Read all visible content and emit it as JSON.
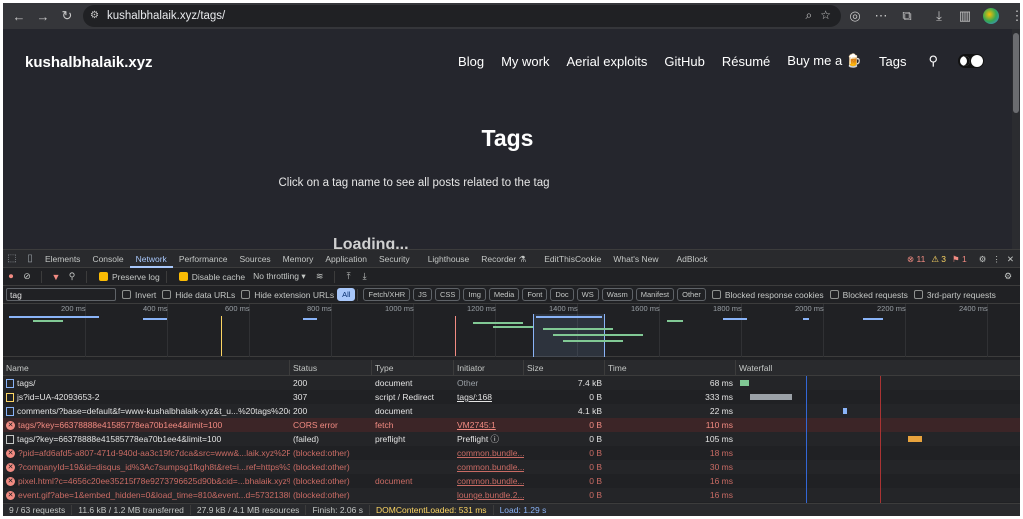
{
  "browser": {
    "url": "kushalbhalaik.xyz/tags/"
  },
  "site": {
    "title": "kushalbhalaik.xyz",
    "nav": [
      "Blog",
      "My work",
      "Aerial exploits",
      "GitHub",
      "Résumé",
      "Buy me a 🍺",
      "Tags"
    ],
    "heading": "Tags",
    "subheading": "Click on a tag name to see all posts related to the tag",
    "loading": "Loading..."
  },
  "devtools": {
    "tabs": [
      "Elements",
      "Console",
      "Network",
      "Performance",
      "Sources",
      "Memory",
      "Application",
      "Security",
      "Lighthouse",
      "Recorder ⚗",
      "EditThisCookie",
      "What's New",
      "AdBlock"
    ],
    "active_tab": "Network",
    "counts": {
      "errors": "11",
      "warnings": "3",
      "info": "1"
    },
    "toolbar": {
      "preserve_log": "Preserve log",
      "disable_cache": "Disable cache",
      "throttling": "No throttling"
    },
    "filter": {
      "value": "tag",
      "invert": "Invert",
      "hide_data_urls": "Hide data URLs",
      "hide_ext_urls": "Hide extension URLs",
      "types": [
        "All",
        "Fetch/XHR",
        "JS",
        "CSS",
        "Img",
        "Media",
        "Font",
        "Doc",
        "WS",
        "Wasm",
        "Manifest",
        "Other"
      ],
      "blocked_cookies": "Blocked response cookies",
      "blocked_requests": "Blocked requests",
      "third_party": "3rd-party requests"
    },
    "overview_ticks": [
      "200 ms",
      "400 ms",
      "600 ms",
      "800 ms",
      "1000 ms",
      "1200 ms",
      "1400 ms",
      "1600 ms",
      "1800 ms",
      "2000 ms",
      "2200 ms",
      "2400 ms"
    ],
    "columns": [
      "Name",
      "Status",
      "Type",
      "Initiator",
      "Size",
      "Time",
      "Waterfall"
    ],
    "rows": [
      {
        "name": "tags/",
        "status": "200",
        "type": "document",
        "initiator": "Other",
        "size": "7.4 kB",
        "time": "68 ms",
        "kind": "doc"
      },
      {
        "name": "js?id=UA-42093653-2",
        "status": "307",
        "type": "script / Redirect",
        "initiator": "tags/:168",
        "size": "0 B",
        "time": "333 ms",
        "kind": "js"
      },
      {
        "name": "comments/?base=default&f=www-kushalbhalaik-xyz&t_u...%20tags%20on...",
        "status": "200",
        "type": "document",
        "initiator": "",
        "size": "4.1 kB",
        "time": "22 ms",
        "kind": "doc"
      },
      {
        "name": "tags/?key=66378888e41585778ea70b1ee4&limit=100",
        "status": "CORS error",
        "type": "fetch",
        "initiator": "VM2745:1",
        "size": "0 B",
        "time": "110 ms",
        "kind": "err"
      },
      {
        "name": "tags/?key=66378888e41585778ea70b1ee4&limit=100",
        "status": "(failed)",
        "type": "preflight",
        "initiator": "Preflight ⓘ",
        "size": "0 B",
        "time": "105 ms",
        "kind": "pre"
      },
      {
        "name": "?pid=afd6afd5-a807-471d-940d-aa3c19fc7dca&src=www&...laik.xyz%2Fta...",
        "status": "(blocked:other)",
        "type": "",
        "initiator": "common.bundle...",
        "size": "0 B",
        "time": "18 ms",
        "kind": "blk"
      },
      {
        "name": "?companyId=19&id=disqus_id%3Ac7sumpsg1fkgh8t&ret=i...ref=https%3...",
        "status": "(blocked:other)",
        "type": "",
        "initiator": "common.bundle...",
        "size": "0 B",
        "time": "30 ms",
        "kind": "blk"
      },
      {
        "name": "pixel.html?c=4656c20ee35215f78e9273796625d90b&cid=...bhalaik.xyz%2F...",
        "status": "(blocked:other)",
        "type": "document",
        "initiator": "common.bundle...",
        "size": "0 B",
        "time": "16 ms",
        "kind": "blk"
      },
      {
        "name": "event.gif?abe=1&embed_hidden=0&load_time=810&event...d=57321380...",
        "status": "(blocked:other)",
        "type": "",
        "initiator": "lounge.bundle.2...",
        "size": "0 B",
        "time": "16 ms",
        "kind": "blk"
      }
    ],
    "status": {
      "requests": "9 / 63 requests",
      "transferred": "11.6 kB / 1.2 MB transferred",
      "resources": "27.9 kB / 4.1 MB resources",
      "finish": "Finish: 2.06 s",
      "dcl": "DOMContentLoaded: 531 ms",
      "load": "Load: 1.29 s"
    }
  }
}
